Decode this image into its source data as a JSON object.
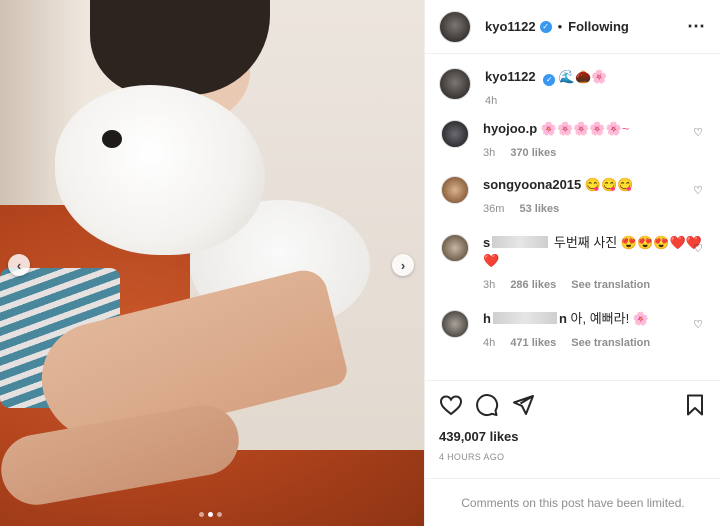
{
  "post_media": {
    "alt": "Photo of woman hugging white dog",
    "carousel_dots": 3,
    "active_dot": 1
  },
  "header": {
    "username": "kyo1122",
    "separator": "•",
    "follow_state": "Following",
    "more_icon": "more-horizontal-icon"
  },
  "caption": {
    "username": "kyo1122",
    "text": "🌊🌰🌸",
    "time": "4h"
  },
  "comments": [
    {
      "username": "hyojoo.p",
      "text": "🌸🌸🌸🌸🌸~",
      "time": "3h",
      "likes": "370 likes"
    },
    {
      "username": "songyoona2015",
      "text": "😋😋😋",
      "time": "36m",
      "likes": "53 likes"
    },
    {
      "username_visible_start": "s",
      "username_visible_end": "",
      "text": "두번째 사진 😍😍😍❤️❤️❤️",
      "time": "3h",
      "likes": "286 likes",
      "translate": "See translation"
    },
    {
      "username_visible_start": "h",
      "username_visible_end": "n",
      "text": "아, 예뻐라! 🌸",
      "time": "4h",
      "likes": "471 likes",
      "translate": "See translation"
    }
  ],
  "actions": {
    "likes_count": "439,007 likes",
    "timestamp": "4 HOURS AGO",
    "comments_limited": "Comments on this post have been limited."
  },
  "colors": {
    "verified": "#3897f0",
    "muted": "#8e8e8e",
    "text": "#262626"
  }
}
